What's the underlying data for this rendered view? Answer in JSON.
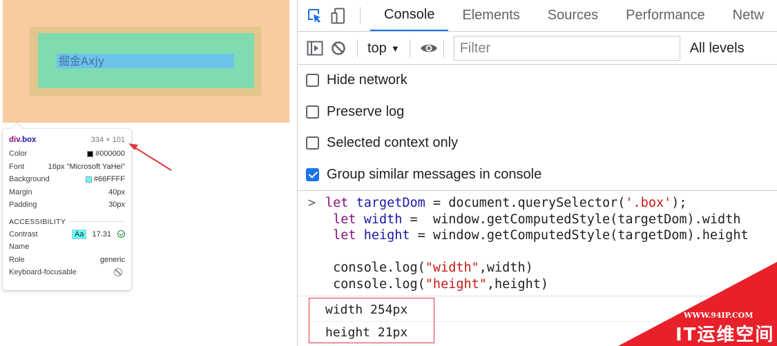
{
  "preview": {
    "content_text": "掘金Axjy"
  },
  "tooltip": {
    "tag": "div",
    "class_name": ".box",
    "size": "334 × 101",
    "rows": [
      {
        "label": "Color",
        "value": "#000000"
      },
      {
        "label": "Font",
        "value": "16px \"Microsoft YaHei\""
      },
      {
        "label": "Background",
        "value": "#66FFFF"
      },
      {
        "label": "Margin",
        "value": "40px"
      },
      {
        "label": "Padding",
        "value": "30px"
      }
    ],
    "accessibility_title": "ACCESSIBILITY",
    "contrast_label": "Contrast",
    "contrast_badge": "Aa",
    "contrast_value": "17.31",
    "name_label": "Name",
    "role_label": "Role",
    "role_value": "generic",
    "focusable_label": "Keyboard-focusable"
  },
  "devtools": {
    "tabs": [
      "Console",
      "Elements",
      "Sources",
      "Performance",
      "Netw"
    ],
    "active_tab": "Console",
    "context": "top",
    "filter_placeholder": "Filter",
    "levels": "All levels",
    "settings": [
      {
        "label": "Hide network",
        "checked": false
      },
      {
        "label": "Preserve log",
        "checked": false
      },
      {
        "label": "Selected context only",
        "checked": false
      },
      {
        "label": "Group similar messages in console",
        "checked": true
      }
    ],
    "prompt_symbol": ">",
    "code": {
      "l1_kw": "let",
      "l1_var": "targetDom",
      "l1_rest": " = document.querySelector(",
      "l1_str": "'.box'",
      "l1_end": ");",
      "l2_kw": "let",
      "l2_var": "width",
      "l2_rest": " =  window.getComputedStyle(targetDom).width",
      "l3_kw": "let",
      "l3_var": "height",
      "l3_rest": " = window.getComputedStyle(targetDom).height",
      "l5_pre": "console.log(",
      "l5_str": "\"width\"",
      "l5_end": ",width)",
      "l6_pre": "console.log(",
      "l6_str": "\"height\"",
      "l6_end": ",height)"
    },
    "outputs": [
      "width 254px",
      "height 21px"
    ]
  },
  "watermark": {
    "url": "WWW.94IP.COM",
    "brand": "IT运维空间"
  },
  "colors": {
    "accent": "#1a73e8",
    "annotation_red": "#e0383e",
    "margin_overlay": "#f8cba0",
    "padding_overlay": "#7fdbb0",
    "content_overlay": "#6cc4e8",
    "watermark_red": "#e8202a"
  }
}
